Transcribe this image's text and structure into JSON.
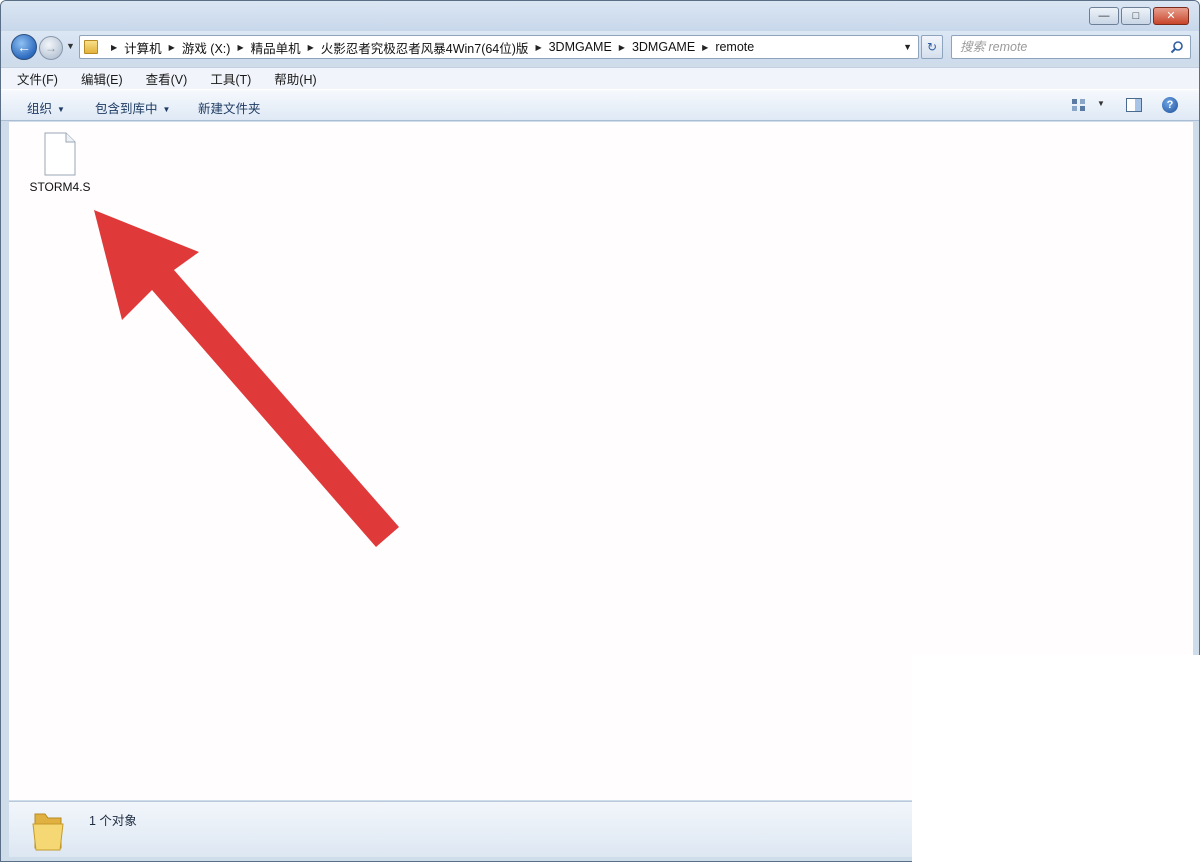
{
  "window": {
    "minimize_glyph": "—",
    "maximize_glyph": "□",
    "close_glyph": "✕"
  },
  "navigation": {
    "back_glyph": "←",
    "forward_glyph": "→",
    "breadcrumbs": [
      "计算机",
      "游戏 (X:)",
      "精品单机",
      "火影忍者究极忍者风暴4Win7(64位)版",
      "3DMGAME",
      "3DMGAME",
      "remote"
    ],
    "refresh_glyph": "↻"
  },
  "search": {
    "placeholder": "搜索 remote"
  },
  "menu": {
    "items": [
      "文件(F)",
      "编辑(E)",
      "查看(V)",
      "工具(T)",
      "帮助(H)"
    ]
  },
  "toolbar": {
    "organize_label": "组织",
    "include_in_library_label": "包含到库中",
    "new_folder_label": "新建文件夹",
    "help_glyph": "?"
  },
  "files": [
    {
      "name": "STORM4.S",
      "icon": "generic-file-icon"
    }
  ],
  "status": {
    "item_count_text": "1 个对象"
  },
  "colors": {
    "annotation_arrow": "#e0393a",
    "window_chrome": "#cfdcea",
    "content_background": "#fffdfe"
  }
}
